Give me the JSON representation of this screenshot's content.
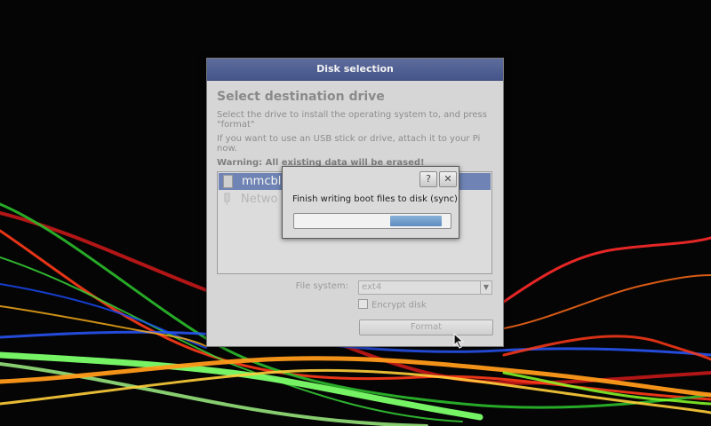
{
  "dialog": {
    "title": "Disk selection",
    "heading": "Select destination drive",
    "instruction": "Select the drive to install the operating system to, and press \"format\"",
    "usb_hint": "If you want to use an USB stick or drive, attach it to your Pi now.",
    "warning": "Warning: All existing data will be erased!",
    "drives": [
      {
        "label": "mmcbl",
        "selected": true
      },
      {
        "label": "Netwo",
        "selected": false
      }
    ],
    "filesystem_label": "File system:",
    "filesystem_value": "ext4",
    "encrypt_label": "Encrypt disk",
    "encrypt_checked": false,
    "format_button": "Format"
  },
  "progress": {
    "help_symbol": "?",
    "close_symbol": "✕",
    "message": "Finish writing boot files to disk (sync)"
  },
  "colors": {
    "titlebar": "#4f5e92",
    "selection": "#6f84b4",
    "progress_fill": "#6f98c8"
  }
}
